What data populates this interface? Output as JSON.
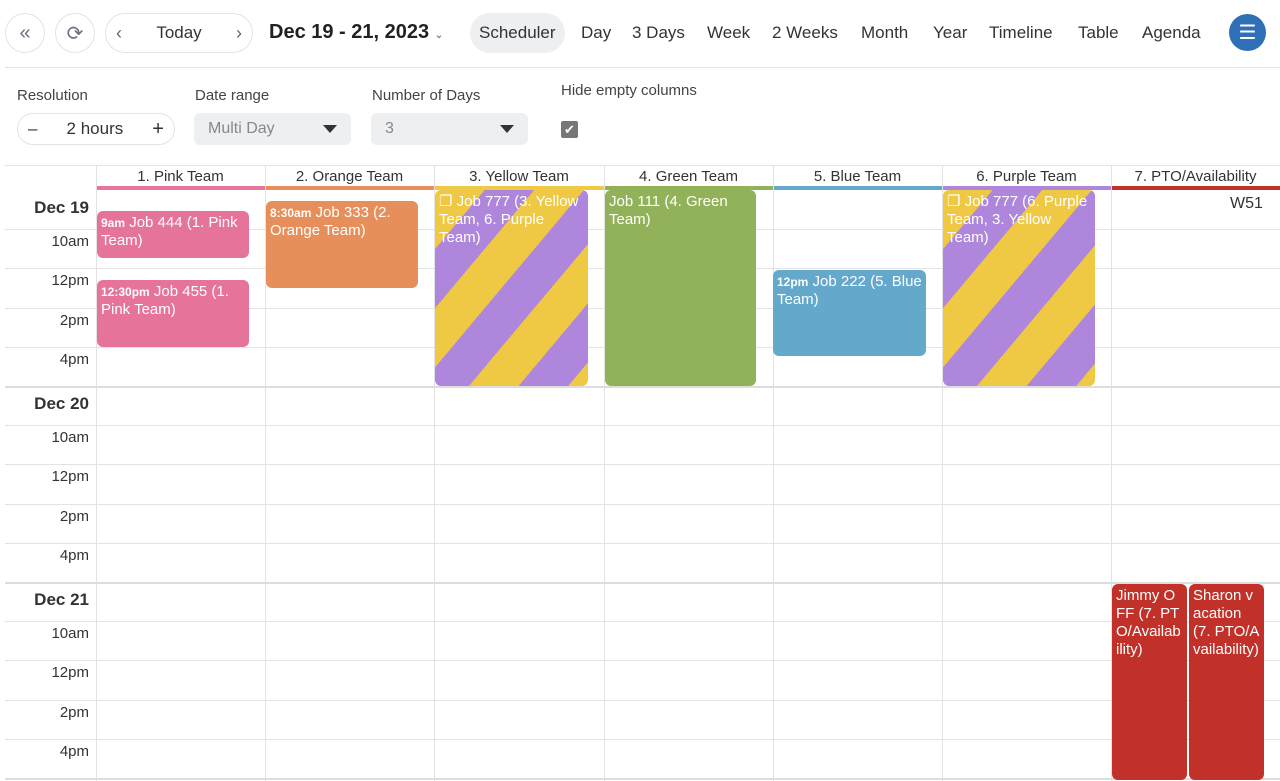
{
  "toolbar": {
    "collapse_icon": "double-chevron-left-icon",
    "refresh_icon": "refresh-icon",
    "today_label": "Today",
    "date_range_title": "Dec 19 - 21, 2023",
    "views": [
      "Scheduler",
      "Day",
      "3 Days",
      "Week",
      "2 Weeks",
      "Month",
      "Year",
      "Timeline",
      "Table",
      "Agenda"
    ],
    "active_view": "Scheduler",
    "menu_icon": "hamburger-menu-icon",
    "accent": "#2f6fb5"
  },
  "options": {
    "resolution_label": "Resolution",
    "resolution_value": "2 hours",
    "date_range_label": "Date range",
    "date_range_value": "Multi Day",
    "days_label": "Number of Days",
    "days_value": "3",
    "hide_empty_label": "Hide empty columns",
    "hide_empty_checked": true
  },
  "columns": [
    {
      "name": "1. Pink Team",
      "color": "#e5739a"
    },
    {
      "name": "2. Orange Team",
      "color": "#e78f5a"
    },
    {
      "name": "3. Yellow Team",
      "color": "#f0c944"
    },
    {
      "name": "4. Green Team",
      "color": "#92b259"
    },
    {
      "name": "5. Blue Team",
      "color": "#64a8cb"
    },
    {
      "name": "6. Purple Team",
      "color": "#ae87dc"
    },
    {
      "name": "7. PTO/Availability",
      "color": "#c1312a"
    }
  ],
  "week_label": "W51",
  "days": [
    {
      "date": "Dec 19",
      "slots": [
        "10am",
        "12pm",
        "2pm",
        "4pm"
      ]
    },
    {
      "date": "Dec 20",
      "slots": [
        "10am",
        "12pm",
        "2pm",
        "4pm"
      ]
    },
    {
      "date": "Dec 21",
      "slots": [
        "10am",
        "12pm",
        "2pm",
        "4pm"
      ]
    }
  ],
  "events": [
    {
      "time": "9am",
      "title": "Job 444 (1. Pink Team)",
      "color": "#e5739a"
    },
    {
      "time": "12:30pm",
      "title": "Job 455 (1. Pink Team)",
      "color": "#e5739a"
    },
    {
      "time": "8:30am",
      "title": "Job 333 (2. Orange Team)",
      "color": "#e78f5a"
    },
    {
      "time": "",
      "title": "Job 777 (3. Yellow Team, 6. Purple Team)",
      "icon": "copy-icon"
    },
    {
      "time": "",
      "title": "Job 111 (4. Green Team)",
      "color": "#92b259"
    },
    {
      "time": "12pm",
      "title": "Job 222 (5. Blue Team)",
      "color": "#64a8cb"
    },
    {
      "time": "",
      "title": "Job 777 (6. Purple Team, 3. Yellow Team)",
      "icon": "copy-icon"
    },
    {
      "time": "",
      "title": "Jimmy OFF (7. PTO/Availability)",
      "color": "#c1312a"
    },
    {
      "time": "",
      "title": "Sharon vacation (7. PTO/Availability)",
      "color": "#c1312a"
    }
  ]
}
